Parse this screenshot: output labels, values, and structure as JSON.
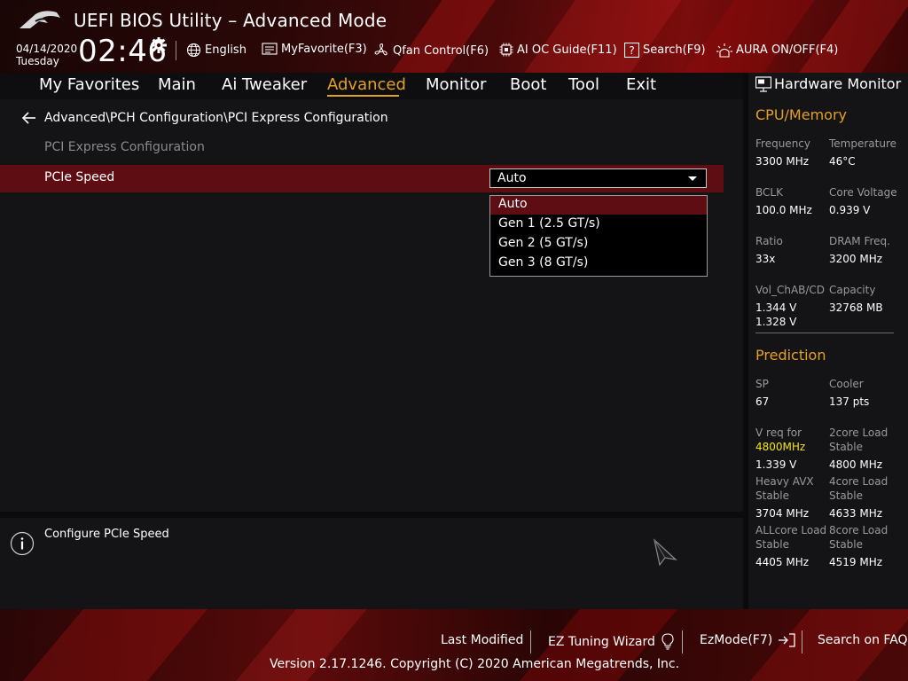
{
  "header": {
    "title": "UEFI BIOS Utility – Advanced Mode",
    "date": "04/14/2020",
    "day": "Tuesday",
    "time": "02:46",
    "tools": {
      "language": "English",
      "favorite": "MyFavorite(F3)",
      "qfan": "Qfan Control(F6)",
      "aioc": "AI OC Guide(F11)",
      "search": "Search(F9)",
      "aura": "AURA ON/OFF(F4)"
    }
  },
  "menu": {
    "items": [
      "My Favorites",
      "Main",
      "Ai Tweaker",
      "Advanced",
      "Monitor",
      "Boot",
      "Tool",
      "Exit"
    ],
    "active": "Advanced"
  },
  "content": {
    "breadcrumb": "Advanced\\PCH Configuration\\PCI Express Configuration",
    "section_title": "PCI Express Configuration",
    "setting": {
      "label": "PCIe Speed",
      "value": "Auto",
      "options": [
        "Auto",
        "Gen 1 (2.5 GT/s)",
        "Gen 2 (5 GT/s)",
        "Gen 3 (8 GT/s)"
      ],
      "selected_option": "Auto"
    }
  },
  "help": {
    "text": "Configure PCIe Speed"
  },
  "hardware_monitor": {
    "title": "Hardware Monitor",
    "cpu_memory": {
      "heading": "CPU/Memory",
      "frequency_label": "Frequency",
      "frequency": "3300 MHz",
      "temperature_label": "Temperature",
      "temperature": "46°C",
      "bclk_label": "BCLK",
      "bclk": "100.0 MHz",
      "core_voltage_label": "Core Voltage",
      "core_voltage": "0.939 V",
      "ratio_label": "Ratio",
      "ratio": "33x",
      "dram_freq_label": "DRAM Freq.",
      "dram_freq": "3200 MHz",
      "vol_label": "Vol_ChAB/CD",
      "vol_ab": "1.344 V",
      "vol_cd": "1.328 V",
      "capacity_label": "Capacity",
      "capacity": "32768 MB"
    },
    "prediction": {
      "heading": "Prediction",
      "sp_label": "SP",
      "sp": "67",
      "cooler_label": "Cooler",
      "cooler": "137 pts",
      "vreq_label": "V req for",
      "vreq_freq": "4800MHz",
      "vreq": "1.339 V",
      "core2_label_1": "2core Load",
      "core2_label_2": "Stable",
      "core2": "4800 MHz",
      "avx_label_1": "Heavy AVX",
      "avx_label_2": "Stable",
      "avx": "3704 MHz",
      "core4_label_1": "4core Load",
      "core4_label_2": "Stable",
      "core4": "4633 MHz",
      "allcore_label_1": "ALLcore Load",
      "allcore_label_2": "Stable",
      "allcore": "4405 MHz",
      "core8_label_1": "8core Load",
      "core8_label_2": "Stable",
      "core8": "4519 MHz"
    }
  },
  "footer": {
    "last_modified": "Last Modified",
    "ez_tuning": "EZ Tuning Wizard",
    "ezmode": "EzMode(F7)",
    "search_faq": "Search on FAQ",
    "version": "Version 2.17.1246. Copyright (C) 2020 American Megatrends, Inc."
  },
  "colors": {
    "accent": "#e4a022",
    "selection": "#5e0d12",
    "highlight": "#f2e21a"
  }
}
